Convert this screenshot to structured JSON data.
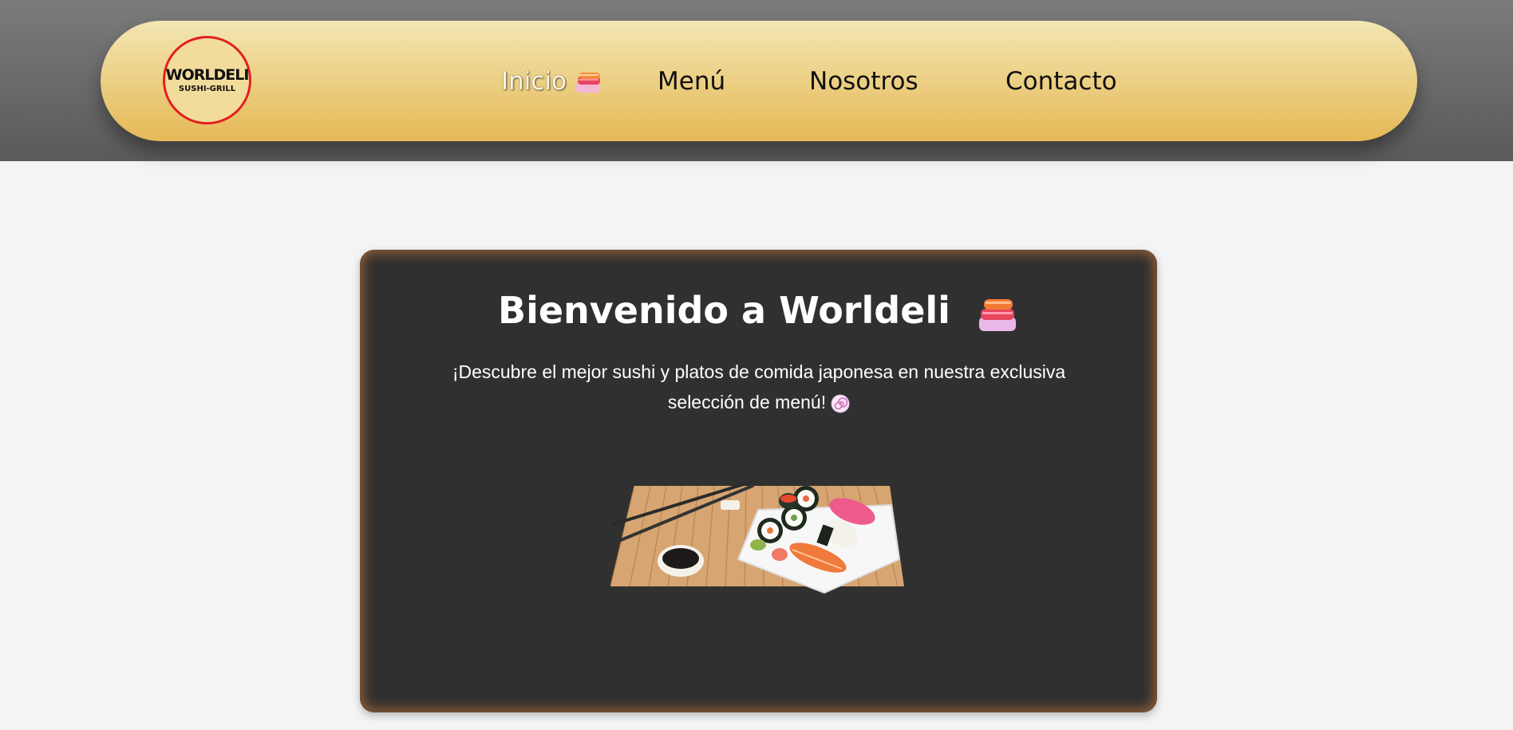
{
  "navbar": {
    "logo": {
      "main_text": "WORLDELI",
      "sub_text": "SUSHI-GRILL"
    },
    "items": [
      {
        "label": "Inicio",
        "active": true,
        "icon": "sushi-icon"
      },
      {
        "label": "Menú",
        "active": false
      },
      {
        "label": "Nosotros",
        "active": false
      },
      {
        "label": "Contacto",
        "active": false
      }
    ]
  },
  "hero": {
    "title": "Bienvenido a Worldeli",
    "title_icon": "sushi-icon",
    "text_line1": "¡Descubre el mejor sushi y platos de comida japonesa en nuestra exclusiva",
    "text_line2": "selección de menú!",
    "text_icon": "naruto-icon",
    "image": "sushi-platter-image"
  },
  "colors": {
    "header_band": "#6b6b6b",
    "navbar_gradient_top": "#f3e6b2",
    "navbar_gradient_bottom": "#e5b956",
    "logo_ring": "#e31f1f",
    "page_background": "#f4f4f4",
    "hero_background": "#303030",
    "hero_glow": "#8a5a36"
  }
}
